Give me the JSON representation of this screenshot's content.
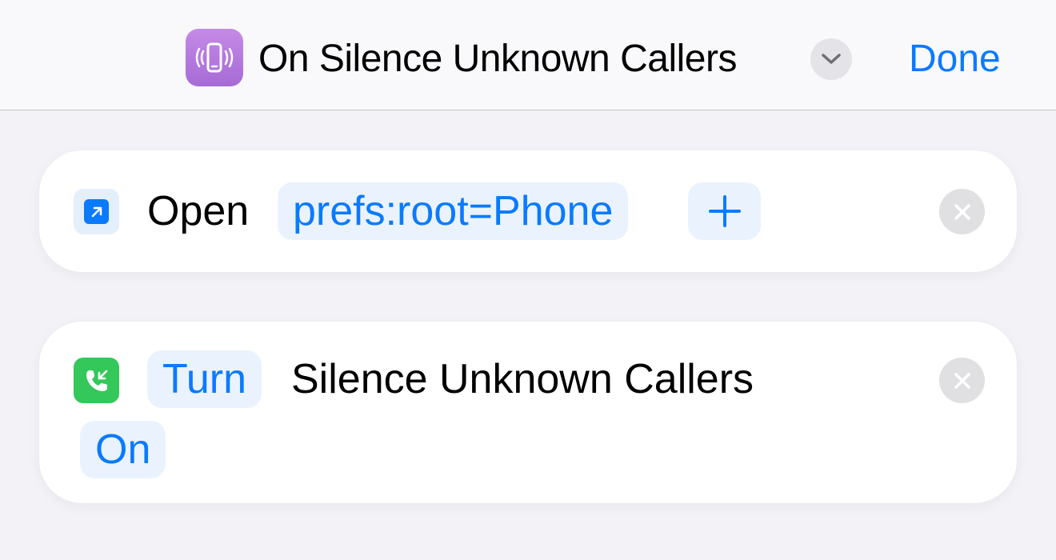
{
  "header": {
    "app_icon": "phone-vibrating-icon",
    "title": "On Silence Unknown Callers",
    "expand_icon": "chevron-down-icon",
    "done_label": "Done"
  },
  "actions": [
    {
      "icon": "open-url-icon",
      "verb": "Open",
      "value": "prefs:root=Phone",
      "add_icon": "plus-icon",
      "remove_icon": "close-icon"
    },
    {
      "icon": "phone-incoming-icon",
      "verb": "Turn",
      "setting": "Silence Unknown Callers",
      "state": "On",
      "remove_icon": "close-icon"
    }
  ],
  "colors": {
    "accent": "#0a7aff",
    "pill_background": "#eaf3fd",
    "app_icon_purple": "#b77ade",
    "phone_green": "#34c759",
    "background": "#f2f2f7"
  }
}
